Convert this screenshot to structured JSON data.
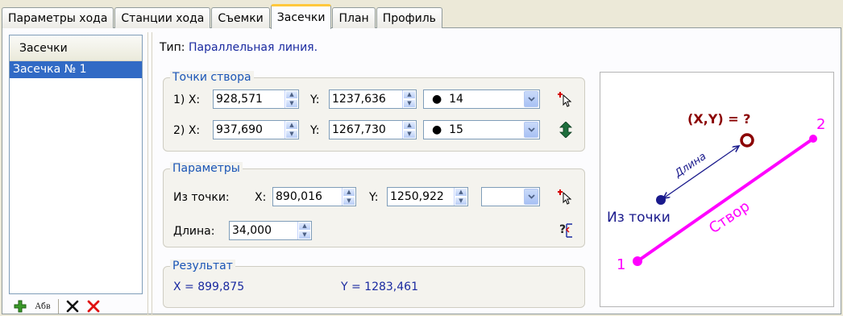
{
  "tabs": [
    {
      "label": "Параметры хода",
      "active": false
    },
    {
      "label": "Станции хода",
      "active": false
    },
    {
      "label": "Съемки",
      "active": false
    },
    {
      "label": "Засечки",
      "active": true
    },
    {
      "label": "План",
      "active": false
    },
    {
      "label": "Профиль",
      "active": false
    }
  ],
  "left_list": {
    "header": "Засечки",
    "items": [
      "Засечка № 1"
    ],
    "toolbar": {
      "add_icon": "plus-icon",
      "rename_label": "Абв",
      "delete_icon": "black-x-icon",
      "delete_all_icon": "red-x-icon"
    }
  },
  "type_line": {
    "label": "Тип:",
    "value": "Параллельная линия."
  },
  "alignment_points": {
    "title": "Точки створа",
    "rows": [
      {
        "prefix": "1) X:",
        "x": "928,571",
        "y_label": "Y:",
        "y": "1237,636",
        "point": "14"
      },
      {
        "prefix": "2) X:",
        "x": "937,690",
        "y_label": "Y:",
        "y": "1267,730",
        "point": "15"
      }
    ]
  },
  "params": {
    "title": "Параметры",
    "from_label": "Из точки:",
    "x_label": "X:",
    "x": "890,016",
    "y_label": "Y:",
    "y": "1250,922",
    "point": "",
    "length_label": "Длина:",
    "length": "34,000"
  },
  "result": {
    "title": "Результат",
    "x_text": "X = 899,875",
    "y_text": "Y = 1283,461"
  },
  "diagram": {
    "question": "(X,Y) = ?",
    "length_label": "Длина",
    "from_label": "Из точки",
    "line_label": "Створ",
    "p1": "1",
    "p2": "2",
    "colors": {
      "line": "#ff00ff",
      "dark": "#1a1a8c",
      "point_red": "#8b0000"
    }
  }
}
